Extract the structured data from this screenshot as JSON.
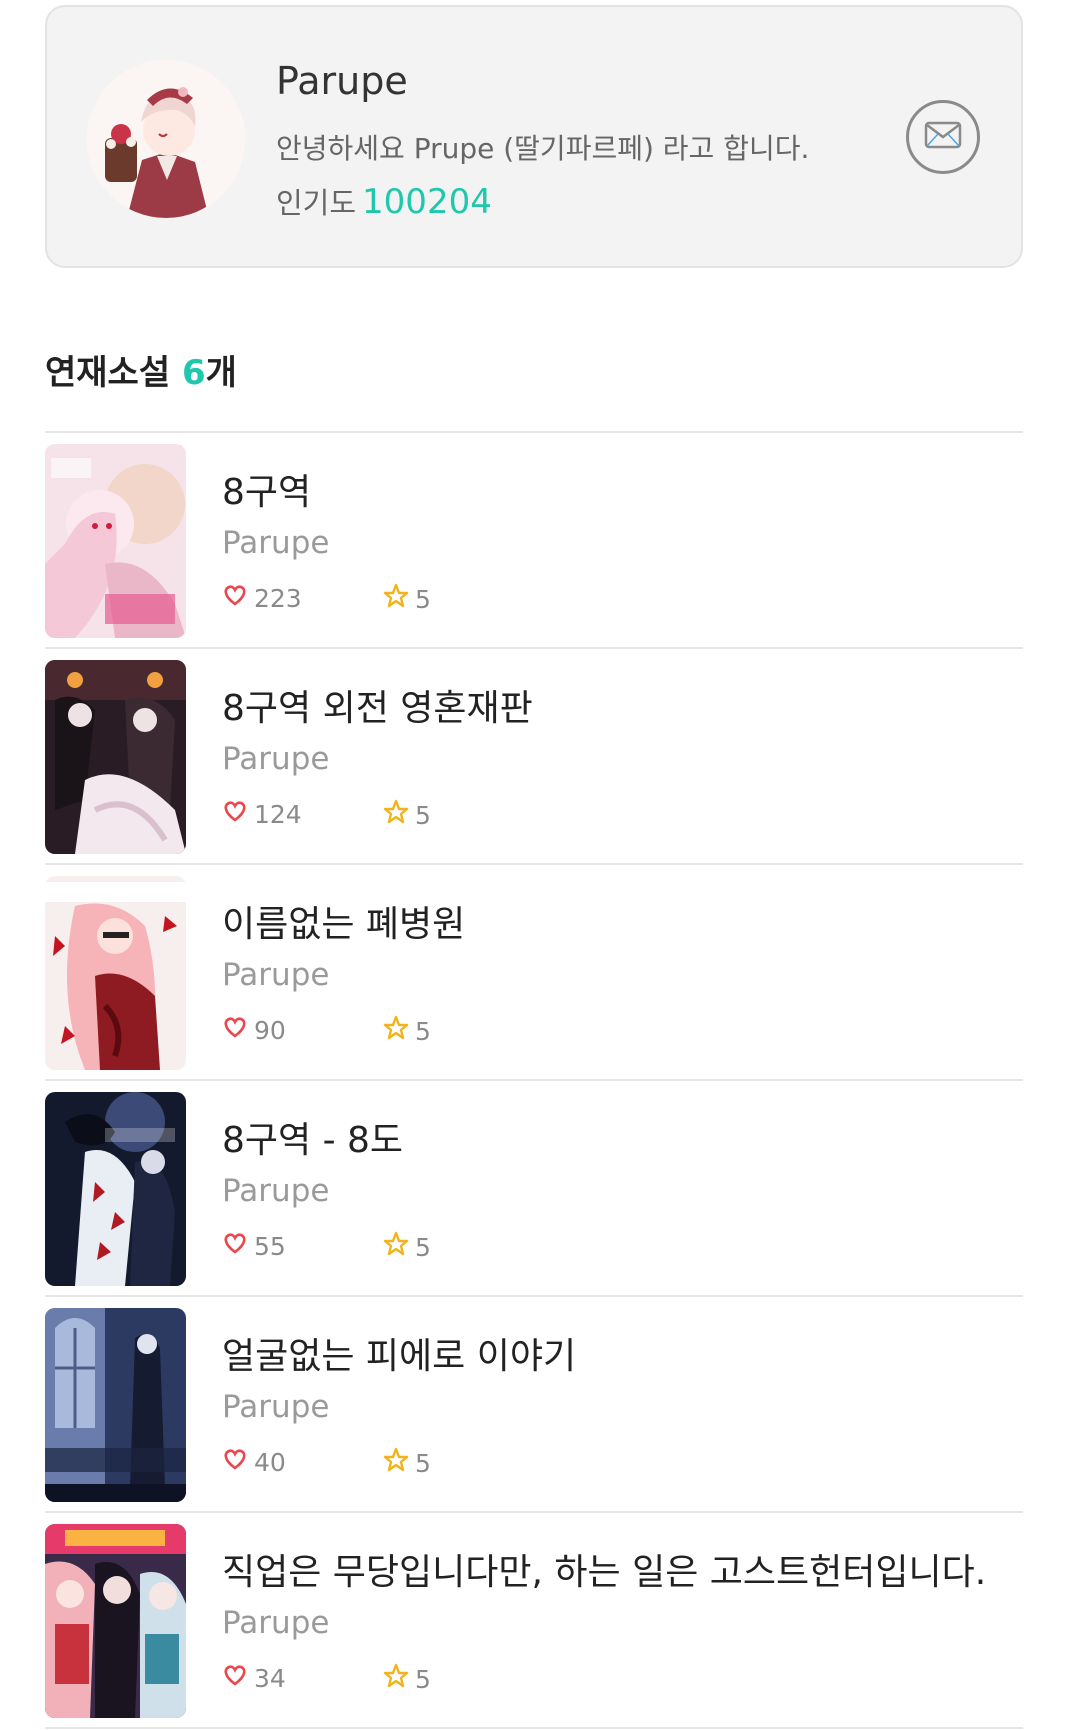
{
  "profile": {
    "name": "Parupe",
    "bio": "안녕하세요 Prupe (딸기파르페) 라고 합니다.",
    "popularity_label": "인기도",
    "popularity_value": "100204"
  },
  "section": {
    "title": "연재소설",
    "count": "6",
    "count_suffix": "개"
  },
  "novels": [
    {
      "title": "8구역",
      "author": "Parupe",
      "likes": "223",
      "rating": "5"
    },
    {
      "title": "8구역 외전 영혼재판",
      "author": "Parupe",
      "likes": "124",
      "rating": "5"
    },
    {
      "title": "이름없는 폐병원",
      "author": "Parupe",
      "likes": "90",
      "rating": "5"
    },
    {
      "title": "8구역 - 8도",
      "author": "Parupe",
      "likes": "55",
      "rating": "5"
    },
    {
      "title": "얼굴없는 피에로 이야기",
      "author": "Parupe",
      "likes": "40",
      "rating": "5"
    },
    {
      "title": "직업은 무당입니다만, 하는 일은 고스트헌터입니다.",
      "author": "Parupe",
      "likes": "34",
      "rating": "5"
    }
  ],
  "colors": {
    "accent": "#1fc8ad",
    "heart": "#e8474c",
    "star": "#f2b21b"
  },
  "icons": {
    "message": "envelope-icon",
    "likes": "heart-icon",
    "rating": "star-icon"
  }
}
